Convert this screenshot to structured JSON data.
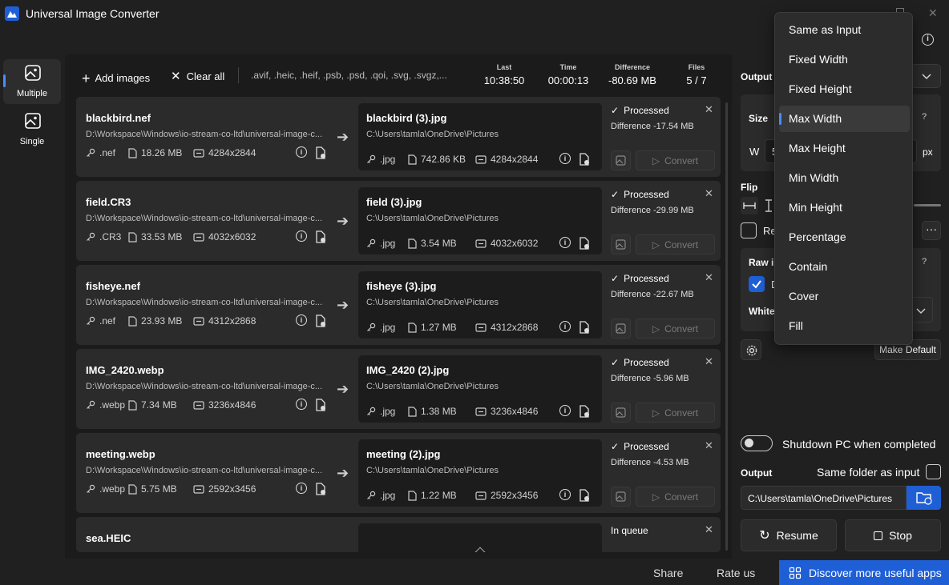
{
  "window": {
    "title": "Universal Image Converter"
  },
  "nav": {
    "items": [
      {
        "label": "Multiple",
        "icon": "image-stack-icon"
      },
      {
        "label": "Single",
        "icon": "image-icon"
      }
    ]
  },
  "toolbar": {
    "add_label": "Add images",
    "clear_label": "Clear all",
    "formats": ".avif, .heic, .heif, .psb, .psd, .qoi, .svg, .svgz,..."
  },
  "stats": [
    {
      "label": "Last",
      "value": "10:38:50"
    },
    {
      "label": "Time",
      "value": "00:00:13"
    },
    {
      "label": "Difference",
      "value": "-80.69 MB"
    },
    {
      "label": "Files",
      "value": "5 / 7"
    }
  ],
  "files": [
    {
      "in_name": "blackbird.nef",
      "in_path": "D:\\Workspace\\Windows\\io-stream-co-ltd\\universal-image-c...",
      "in_ext": ".nef",
      "in_size": "18.26 MB",
      "in_dims": "4284x2844",
      "out_name": "blackbird (3).jpg",
      "out_path": "C:\\Users\\tamla\\OneDrive\\Pictures",
      "out_ext": ".jpg",
      "out_size": "742.86 KB",
      "out_dims": "4284x2844",
      "status": "Processed",
      "diff": "Difference -17.54 MB"
    },
    {
      "in_name": "field.CR3",
      "in_path": "D:\\Workspace\\Windows\\io-stream-co-ltd\\universal-image-c...",
      "in_ext": ".CR3",
      "in_size": "33.53 MB",
      "in_dims": "4032x6032",
      "out_name": "field (3).jpg",
      "out_path": "C:\\Users\\tamla\\OneDrive\\Pictures",
      "out_ext": ".jpg",
      "out_size": "3.54 MB",
      "out_dims": "4032x6032",
      "status": "Processed",
      "diff": "Difference -29.99 MB"
    },
    {
      "in_name": "fisheye.nef",
      "in_path": "D:\\Workspace\\Windows\\io-stream-co-ltd\\universal-image-c...",
      "in_ext": ".nef",
      "in_size": "23.93 MB",
      "in_dims": "4312x2868",
      "out_name": "fisheye (3).jpg",
      "out_path": "C:\\Users\\tamla\\OneDrive\\Pictures",
      "out_ext": ".jpg",
      "out_size": "1.27 MB",
      "out_dims": "4312x2868",
      "status": "Processed",
      "diff": "Difference -22.67 MB"
    },
    {
      "in_name": "IMG_2420.webp",
      "in_path": "D:\\Workspace\\Windows\\io-stream-co-ltd\\universal-image-c...",
      "in_ext": ".webp",
      "in_size": "7.34 MB",
      "in_dims": "3236x4846",
      "out_name": "IMG_2420 (2).jpg",
      "out_path": "C:\\Users\\tamla\\OneDrive\\Pictures",
      "out_ext": ".jpg",
      "out_size": "1.38 MB",
      "out_dims": "3236x4846",
      "status": "Processed",
      "diff": "Difference -5.96 MB"
    },
    {
      "in_name": "meeting.webp",
      "in_path": "D:\\Workspace\\Windows\\io-stream-co-ltd\\universal-image-c...",
      "in_ext": ".webp",
      "in_size": "5.75 MB",
      "in_dims": "2592x3456",
      "out_name": "meeting (2).jpg",
      "out_path": "C:\\Users\\tamla\\OneDrive\\Pictures",
      "out_ext": ".jpg",
      "out_size": "1.22 MB",
      "out_dims": "2592x3456",
      "status": "Processed",
      "diff": "Difference -4.53 MB"
    }
  ],
  "queued_file": {
    "in_name": "sea.HEIC",
    "status": "In queue"
  },
  "convert_label": "Convert",
  "right_panel": {
    "output_format_label": "Output f",
    "size_label": "Size",
    "width_label": "W",
    "width_value": "5",
    "unit": "px",
    "help": "?",
    "flip_label": "Flip",
    "resize_label": "Re",
    "raw_label": "Raw in",
    "raw_check_label": "D",
    "white_label": "White",
    "make_default": "Make Default",
    "shutdown_label": "Shutdown PC when completed",
    "output_label": "Output",
    "same_folder_label": "Same folder as input",
    "output_path": "C:\\Users\\tamla\\OneDrive\\Pictures",
    "resume_label": "Resume",
    "stop_label": "Stop"
  },
  "dropdown": {
    "options": [
      "Same as Input",
      "Fixed Width",
      "Fixed Height",
      "Max Width",
      "Max Height",
      "Min Width",
      "Min Height",
      "Percentage",
      "Contain",
      "Cover",
      "Fill"
    ],
    "selected": "Max Width"
  },
  "footer": {
    "share": "Share",
    "rate": "Rate us",
    "discover": "Discover more useful apps"
  },
  "colors": {
    "accent": "#1f5fd6",
    "highlight": "#4c8bf5",
    "card": "#2b2b2b",
    "background": "#202020"
  }
}
